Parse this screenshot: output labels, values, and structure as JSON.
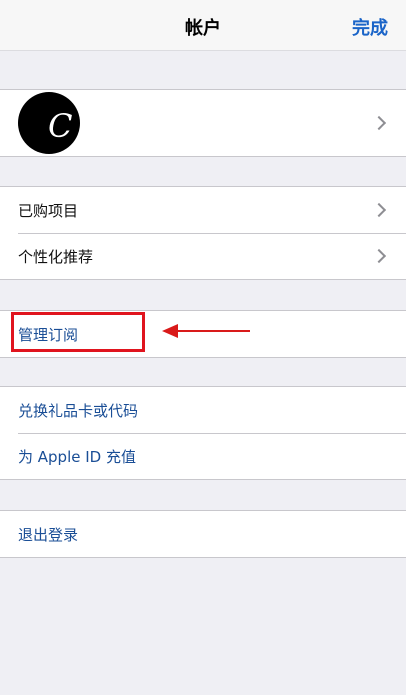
{
  "navbar": {
    "title": "帐户",
    "done_label": "完成"
  },
  "profile": {
    "avatar_letter": "C"
  },
  "group1": {
    "items": [
      {
        "label": "已购项目"
      },
      {
        "label": "个性化推荐"
      }
    ]
  },
  "subscriptions": {
    "label": "管理订阅"
  },
  "group3": {
    "items": [
      {
        "label": "兑换礼品卡或代码"
      },
      {
        "label": "为 Apple ID 充值"
      }
    ]
  },
  "signout": {
    "label": "退出登录"
  },
  "colors": {
    "link": "#1a4e96",
    "done": "#1a64c8",
    "annotation": "#e0141e",
    "background": "#efeff4"
  },
  "icons": [
    "chevron-right-icon",
    "arrow-left-icon"
  ]
}
